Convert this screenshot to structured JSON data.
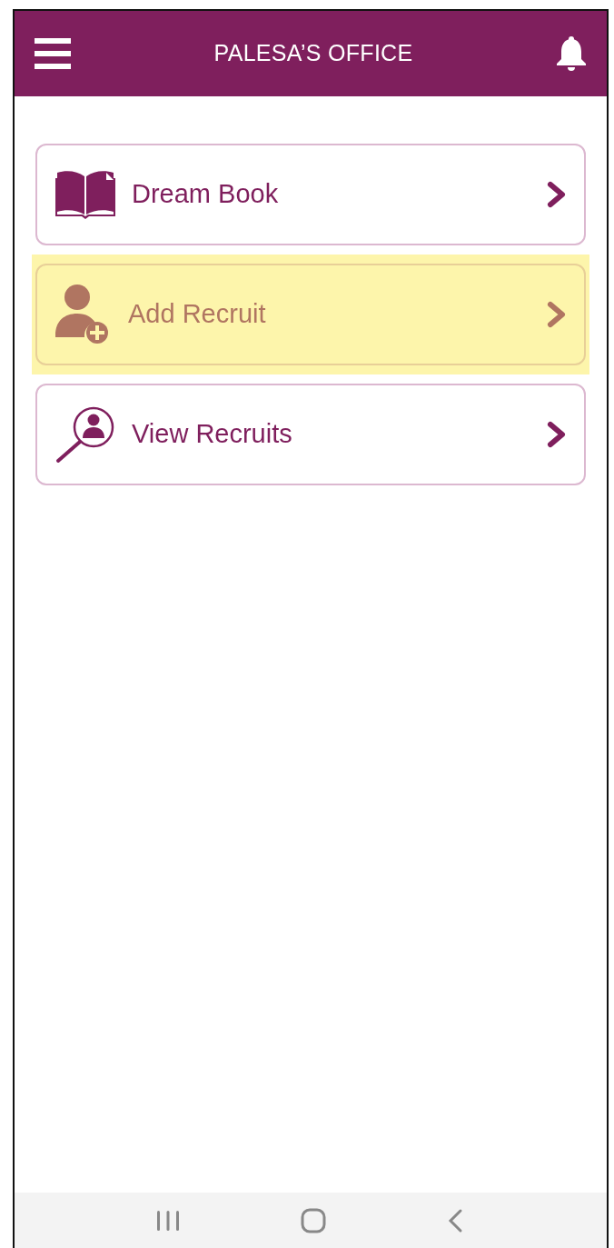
{
  "header": {
    "title": "PALESA’S OFFICE"
  },
  "menu_items": [
    {
      "label": "Dream Book",
      "kind": "book",
      "highlighted": false
    },
    {
      "label": "Add Recruit",
      "kind": "add-person",
      "highlighted": true
    },
    {
      "label": "View Recruits",
      "kind": "search-person",
      "highlighted": false
    }
  ],
  "nav_bar": {
    "buttons": [
      {
        "kind": "recents"
      },
      {
        "kind": "home"
      },
      {
        "kind": "back"
      }
    ]
  }
}
